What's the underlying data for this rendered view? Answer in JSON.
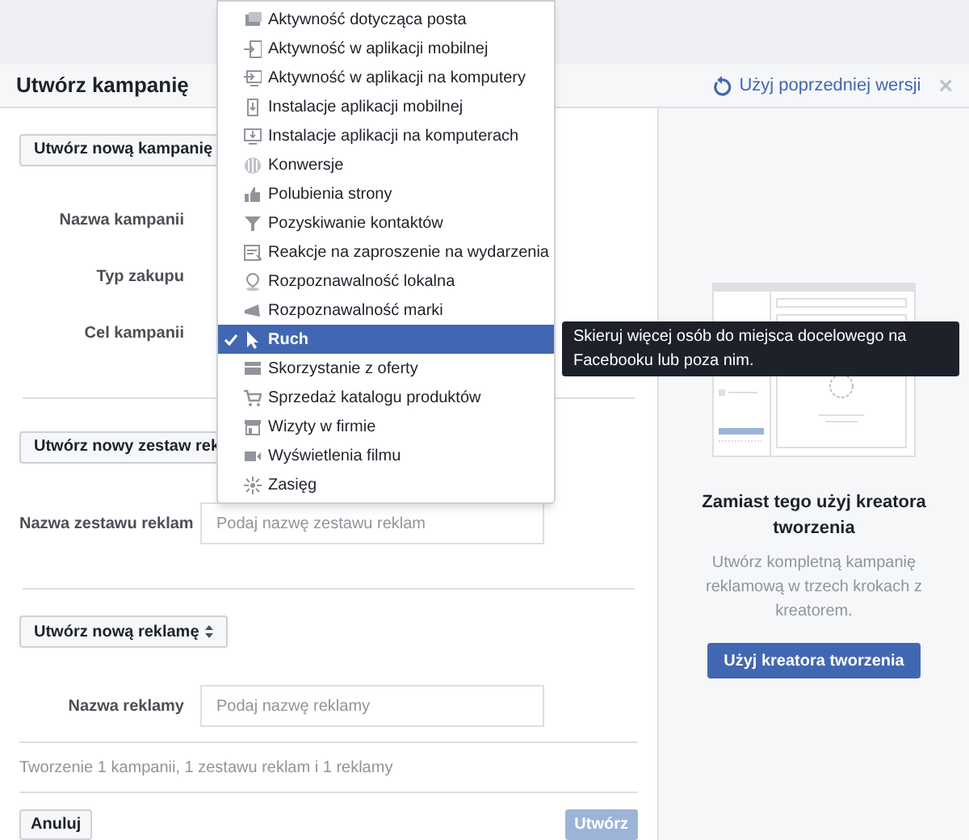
{
  "dialog": {
    "title": "Utwórz kampanię",
    "previous_version_link": "Użyj poprzedniej wersji",
    "close": "×"
  },
  "campaign": {
    "create_button": "Utwórz nową kampanię",
    "fields": [
      {
        "label": "Nazwa kampanii"
      },
      {
        "label": "Typ zakupu"
      },
      {
        "label": "Cel kampanii"
      }
    ]
  },
  "objective_menu": {
    "items": [
      {
        "label": "Aktywność dotycząca posta",
        "selected": false
      },
      {
        "label": "Aktywność w aplikacji mobilnej",
        "selected": false
      },
      {
        "label": "Aktywność w aplikacji na komputery",
        "selected": false
      },
      {
        "label": "Instalacje aplikacji mobilnej",
        "selected": false
      },
      {
        "label": "Instalacje aplikacji na komputerach",
        "selected": false
      },
      {
        "label": "Konwersje",
        "selected": false
      },
      {
        "label": "Polubienia strony",
        "selected": false
      },
      {
        "label": "Pozyskiwanie kontaktów",
        "selected": false
      },
      {
        "label": "Reakcje na zaproszenie na wydarzenia",
        "selected": false
      },
      {
        "label": "Rozpoznawalność lokalna",
        "selected": false
      },
      {
        "label": "Rozpoznawalność marki",
        "selected": false
      },
      {
        "label": "Ruch",
        "selected": true
      },
      {
        "label": "Skorzystanie z oferty",
        "selected": false
      },
      {
        "label": "Sprzedaż katalogu produktów",
        "selected": false
      },
      {
        "label": "Wizyty w firmie",
        "selected": false
      },
      {
        "label": "Wyświetlenia filmu",
        "selected": false
      },
      {
        "label": "Zasięg",
        "selected": false
      }
    ],
    "tooltip": "Skieruj więcej osób do miejsca docelowego na Facebooku lub poza nim."
  },
  "ad_set": {
    "create_button": "Utwórz nowy zestaw rek",
    "name_label": "Nazwa zestawu reklam",
    "name_placeholder": "Podaj nazwę zestawu reklam"
  },
  "ad": {
    "create_button": "Utwórz nową reklamę",
    "name_label": "Nazwa reklamy",
    "name_placeholder": "Podaj nazwę reklamy"
  },
  "summary": "Tworzenie 1 kampanii, 1 zestawu reklam i 1 reklamy",
  "footer": {
    "cancel": "Anuluj",
    "create": "Utwórz",
    "create_disabled": true
  },
  "guided": {
    "title": "Zamiast tego użyj kreatora tworzenia",
    "description": "Utwórz kompletną kampanię reklamową w trzech krokach z kreatorem.",
    "button": "Użyj kreatora tworzenia"
  }
}
